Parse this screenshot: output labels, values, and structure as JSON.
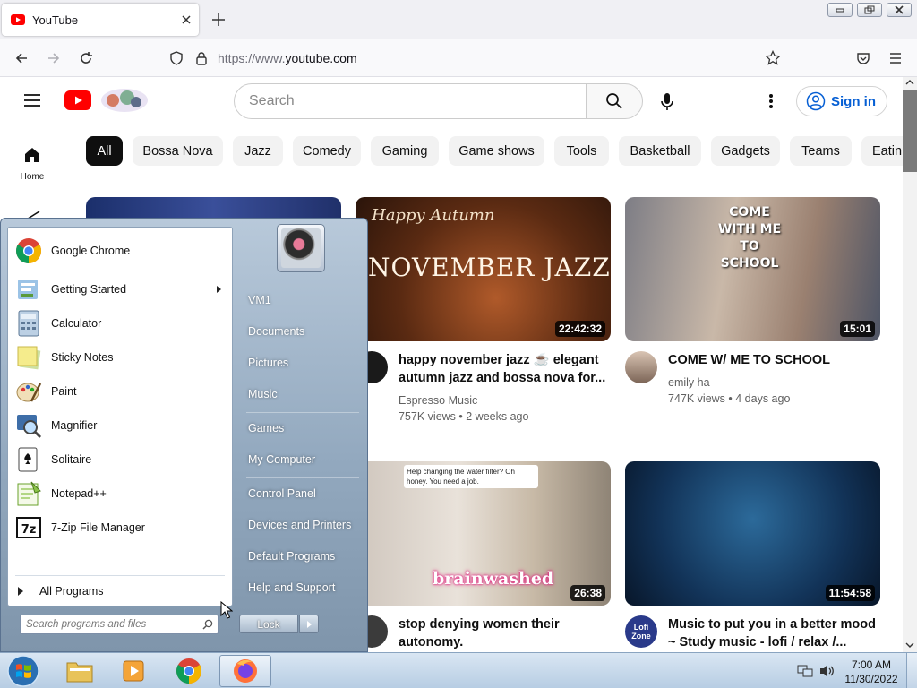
{
  "browser": {
    "tab_title": "YouTube",
    "url_dim": "https://www.",
    "url_host": "youtube.com"
  },
  "youtube": {
    "search_placeholder": "Search",
    "sign_in": "Sign in",
    "home_label": "Home",
    "chips": [
      {
        "label": "All",
        "selected": true
      },
      {
        "label": "Bossa Nova"
      },
      {
        "label": "Jazz"
      },
      {
        "label": "Comedy"
      },
      {
        "label": "Gaming"
      },
      {
        "label": "Game shows"
      },
      {
        "label": "Tools"
      },
      {
        "label": "Basketball"
      },
      {
        "label": "Gadgets"
      },
      {
        "label": "Teams"
      },
      {
        "label": "Eatin"
      }
    ],
    "videos": [
      {
        "title_line1": "happy november jazz ☕ elegant",
        "title_line2": "autumn jazz and bossa nova for...",
        "channel": "Espresso Music",
        "stats": "757K views • 2 weeks ago",
        "duration": "22:42:32",
        "thumb_text": "NOVEMBER JAZZ",
        "thumb_script": "Happy Autumn"
      },
      {
        "title_line1": "COME W/ ME TO SCHOOL",
        "title_line2": "",
        "channel": "emily ha",
        "stats": "747K views • 4 days ago",
        "duration": "15:01",
        "thumb_text": "COME WITH ME TO SCHOOL"
      },
      {
        "title_line1": "stop denying women their",
        "title_line2": "autonomy.",
        "duration": "26:38",
        "thumb_text": "brainwashed",
        "thumb_caption": "Help changing the water filter? Oh honey. You need a job."
      },
      {
        "title_line1": "Music to put you in a better mood",
        "title_line2": "~ Study music - lofi / relax /...",
        "duration": "11:54:58",
        "avatar_text": "Lofi Zone"
      }
    ]
  },
  "start_menu": {
    "left_items": [
      {
        "label": "Google Chrome",
        "icon": "chrome-icon"
      },
      {
        "label": "Getting Started",
        "icon": "getting-started-icon",
        "submenu": true
      },
      {
        "label": "Calculator",
        "icon": "calculator-icon"
      },
      {
        "label": "Sticky Notes",
        "icon": "sticky-notes-icon"
      },
      {
        "label": "Paint",
        "icon": "paint-icon"
      },
      {
        "label": "Magnifier",
        "icon": "magnifier-icon"
      },
      {
        "label": "Solitaire",
        "icon": "solitaire-icon"
      },
      {
        "label": "Notepad++",
        "icon": "notepadpp-icon"
      },
      {
        "label": "7-Zip File Manager",
        "icon": "7zip-icon"
      }
    ],
    "all_programs": "All Programs",
    "search_placeholder": "Search programs and files",
    "right_items": [
      "VM1",
      "Documents",
      "Pictures",
      "Music",
      "Games",
      "My Computer",
      "Control Panel",
      "Devices and Printers",
      "Default Programs",
      "Help and Support"
    ],
    "lock_label": "Lock"
  },
  "taskbar": {
    "time": "7:00 AM",
    "date": "11/30/2022"
  }
}
